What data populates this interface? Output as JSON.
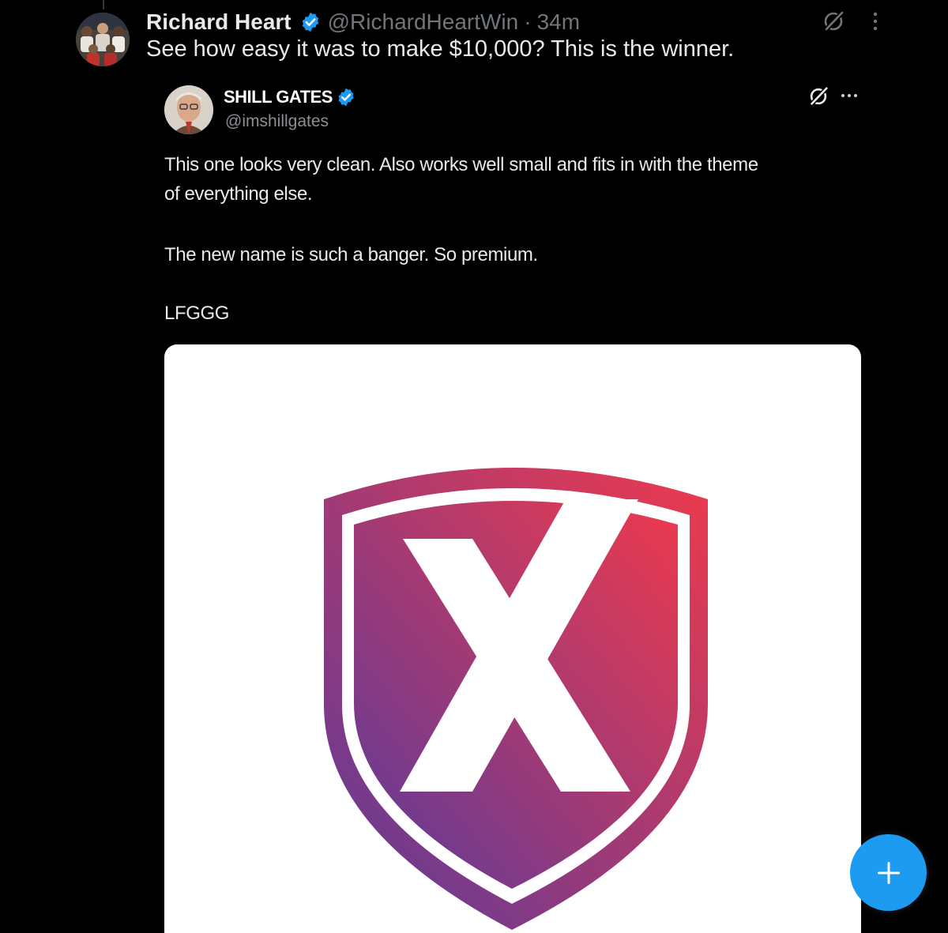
{
  "tweet": {
    "author_name": "Richard Heart",
    "handle": "@RichardHeartWin",
    "separator": "·",
    "time": "34m",
    "text": "See how easy it was to make $10,000? This is the winner.",
    "verified": true
  },
  "quoted_tweet": {
    "author_name": "SHILL GATES",
    "handle": "@imshillgates",
    "verified": true,
    "lines": [
      "This one looks very clean. Also works well small and fits in with the theme",
      "of everything else.",
      "The new name is such a banger. So premium.",
      "LFGGG"
    ],
    "image": {
      "description_icon": "x-shield-logo-icon",
      "gradient_start": "#ee3a4d",
      "gradient_end": "#5a3a9a"
    }
  },
  "fab": {
    "icon": "plus-icon",
    "color": "#1d9bf0"
  }
}
